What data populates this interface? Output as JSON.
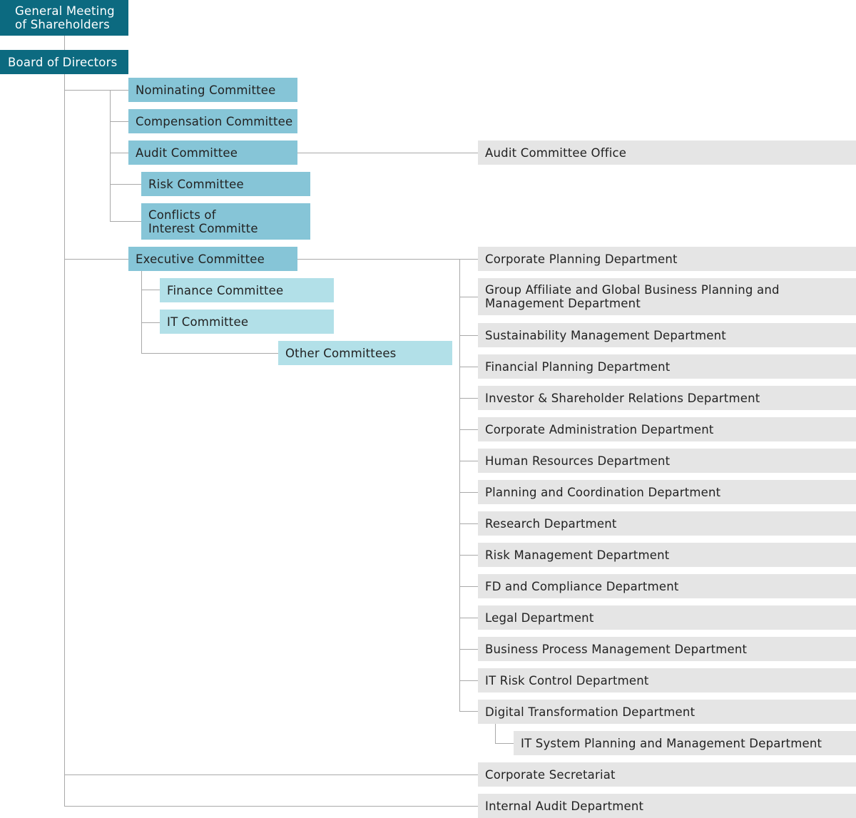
{
  "top": {
    "shareholders": "General Meeting\nof Shareholders",
    "board": "Board of Directors"
  },
  "board_committees": {
    "nominating": "Nominating Committee",
    "compensation": "Compensation Committee",
    "audit": "Audit Committee",
    "risk": "Risk Committee",
    "conflicts": "Conflicts of\nInterest Committe",
    "audit_office": "Audit Committee Office"
  },
  "executive": {
    "title": "Executive Committee",
    "finance": "Finance Committee",
    "it": "IT Committee",
    "other": "Other Committees"
  },
  "departments": [
    "Corporate Planning Department",
    "Group Affiliate and Global Business Planning and\nManagement Department",
    "Sustainability Management Department",
    "Financial Planning Department",
    "Investor & Shareholder Relations Department",
    "Corporate Administration Department",
    "Human Resources Department",
    "Planning and Coordination Department",
    "Research Department",
    "Risk Management Department",
    "FD and Compliance Department",
    "Legal Department",
    "Business Process Management Department",
    "IT Risk Control Department",
    "Digital Transformation Department"
  ],
  "sub_department": "IT System Planning and Management Department",
  "board_units": {
    "secretariat": "Corporate Secretariat",
    "internal_audit": "Internal Audit Department"
  },
  "colors": {
    "dark": "#0c6a80",
    "committee": "#86c5d7",
    "sub_committee": "#b2e0e8",
    "department": "#e5e5e5",
    "connector": "#a9a9a9"
  }
}
